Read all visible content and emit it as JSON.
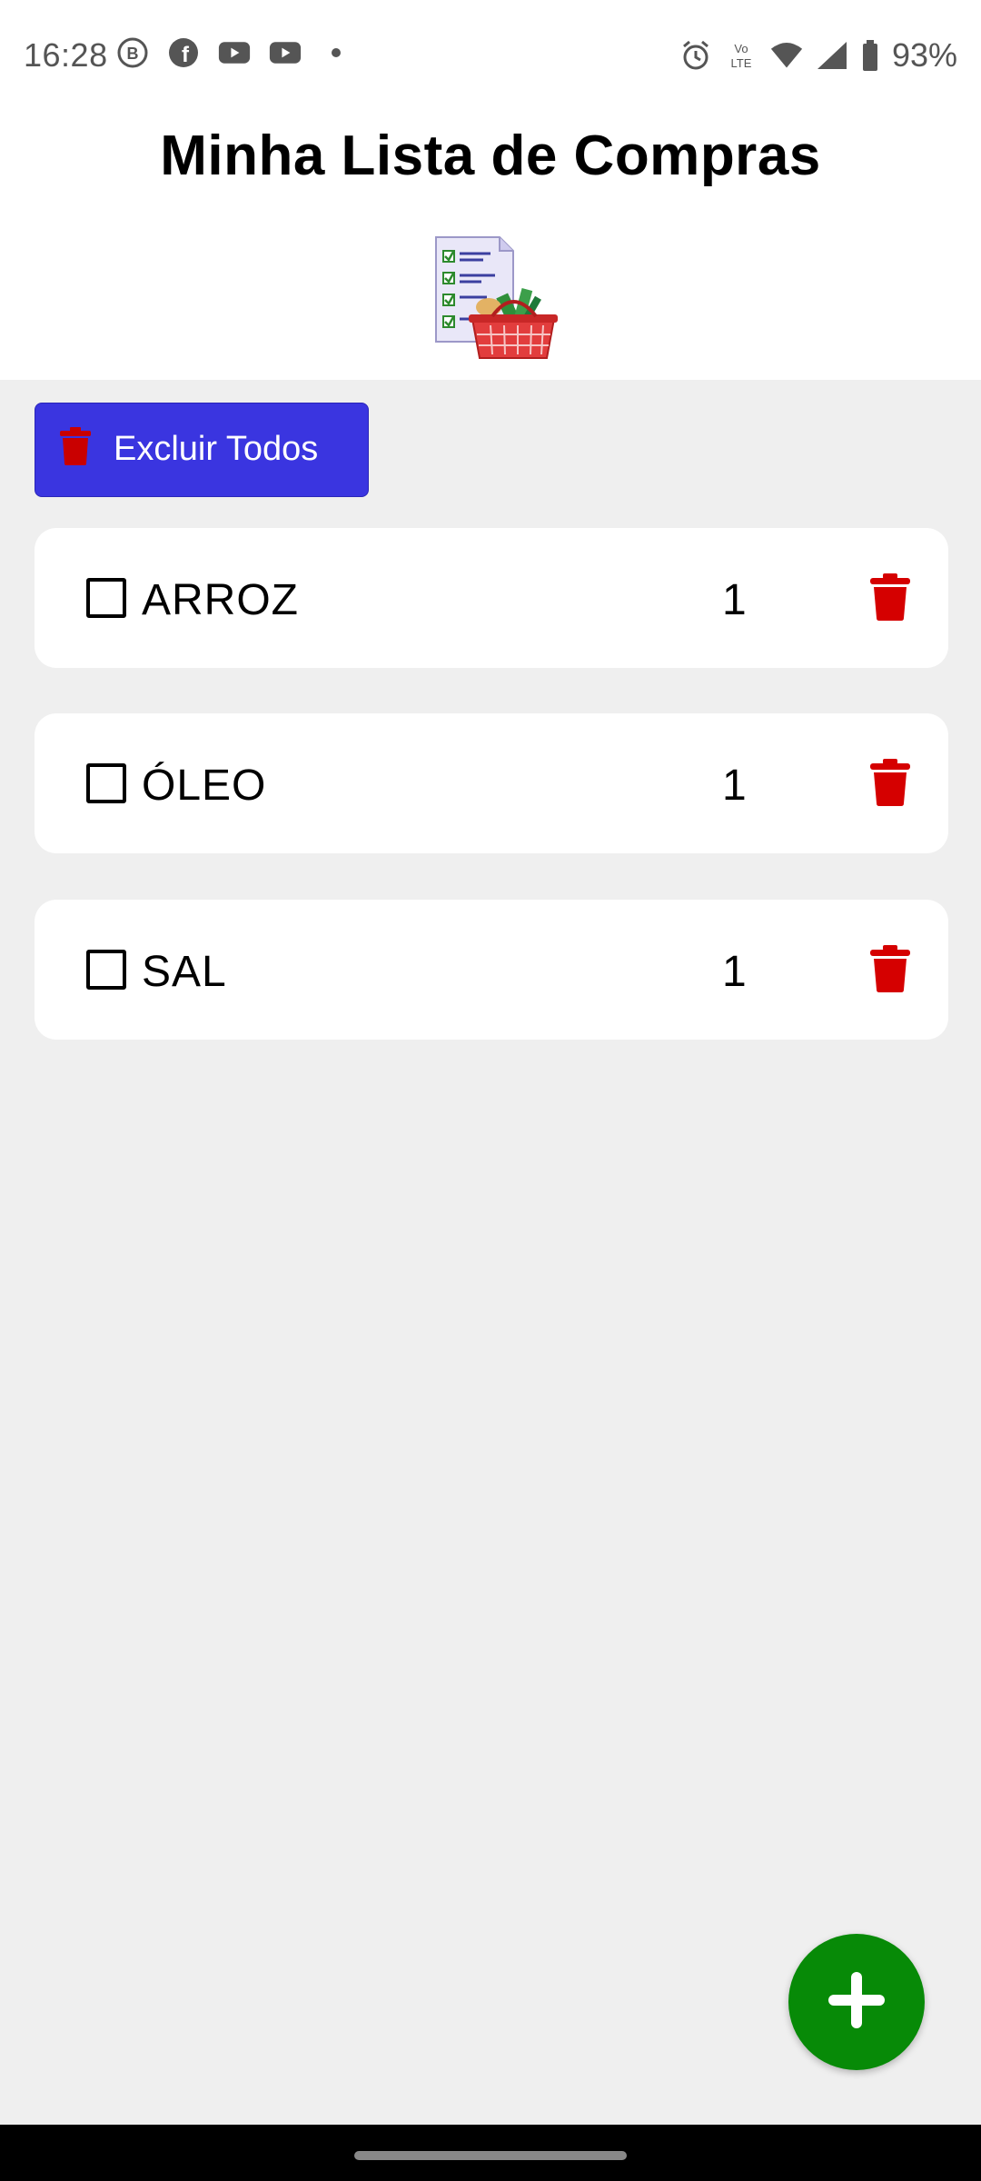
{
  "status_bar": {
    "time": "16:28",
    "battery": "93%",
    "left_icons": [
      "b-circle-icon",
      "facebook-icon",
      "youtube-icon",
      "youtube-icon",
      "dot-icon"
    ],
    "right_icons": [
      "alarm-icon",
      "volte-icon",
      "wifi-icon",
      "signal-icon",
      "battery-icon"
    ]
  },
  "header": {
    "title": "Minha Lista de Compras",
    "logo_icon": "shopping-list-basket-icon"
  },
  "actions": {
    "delete_all_label": "Excluir Todos",
    "delete_all_icon": "trash-icon"
  },
  "items": [
    {
      "name": "ARROZ",
      "quantity": "1",
      "checked": false
    },
    {
      "name": "ÓLEO",
      "quantity": "1",
      "checked": false
    },
    {
      "name": "SAL",
      "quantity": "1",
      "checked": false
    }
  ],
  "fab": {
    "icon": "plus-icon"
  },
  "colors": {
    "primary_button": "#3a35e0",
    "delete_red": "#d50000",
    "fab_green": "#078a07",
    "background": "#efefef"
  }
}
